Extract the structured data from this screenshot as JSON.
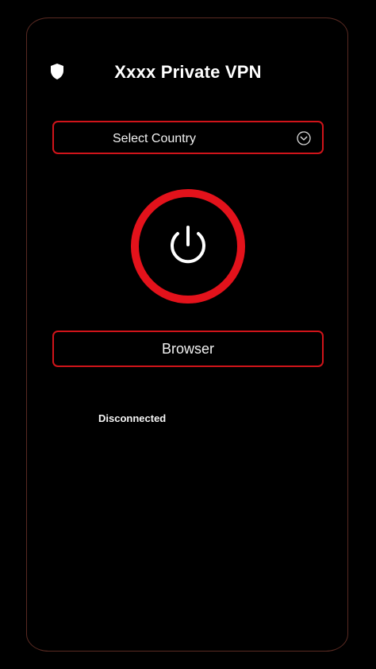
{
  "header": {
    "title": "Xxxx Private VPN",
    "icon": "shield-icon"
  },
  "country_select": {
    "label": "Select Country",
    "icon": "chevron-down-circle-icon"
  },
  "power": {
    "icon": "power-icon"
  },
  "browser": {
    "label": "Browser"
  },
  "status": {
    "text": "Disconnected"
  },
  "colors": {
    "background": "#000000",
    "accent": "#d0141a",
    "text": "#ffffff",
    "frame_border": "#5a2a22"
  }
}
